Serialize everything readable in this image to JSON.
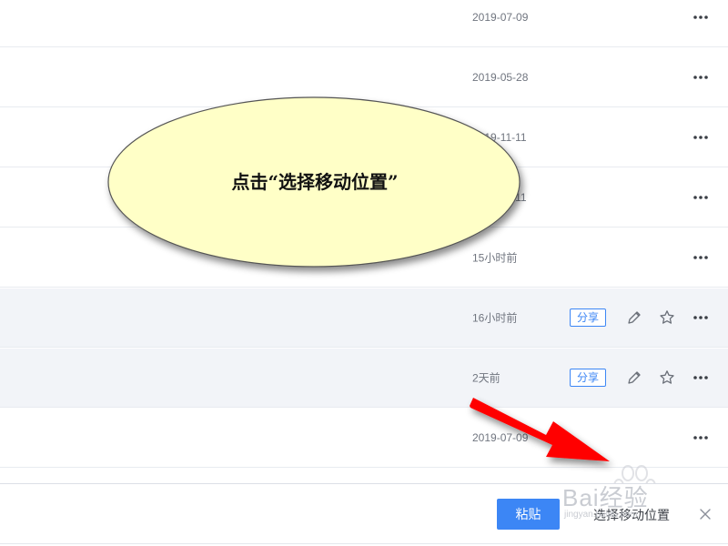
{
  "file_list": {
    "rows": [
      {
        "date": "2019-07-09",
        "highlighted": false,
        "show_actions": false
      },
      {
        "date": "2019-05-28",
        "highlighted": false,
        "show_actions": false
      },
      {
        "date": "2019-11-11",
        "highlighted": false,
        "show_actions": false
      },
      {
        "date": "2018-11-11",
        "highlighted": false,
        "show_actions": false
      },
      {
        "date": "15小时前",
        "highlighted": false,
        "show_actions": false
      },
      {
        "date": "16小时前",
        "highlighted": true,
        "show_actions": true,
        "share_label": "分享"
      },
      {
        "date": "2天前",
        "highlighted": true,
        "show_actions": true,
        "share_label": "分享"
      },
      {
        "date": "2019-07-09",
        "highlighted": false,
        "show_actions": false
      }
    ]
  },
  "bottom_bar": {
    "paste_label": "粘贴",
    "move_label": "选择移动位置"
  },
  "annotation": {
    "callout_text": "点击“选择移动位置”",
    "callout_fill": "#ffffc7",
    "arrow_color": "#ff0000"
  },
  "watermark": {
    "text": "Bai经验",
    "sub": "jingyan.baidu.com"
  },
  "colors": {
    "accent": "#3c86f5",
    "row_highlight": "#f2f4f8",
    "text_muted": "#70757f"
  }
}
